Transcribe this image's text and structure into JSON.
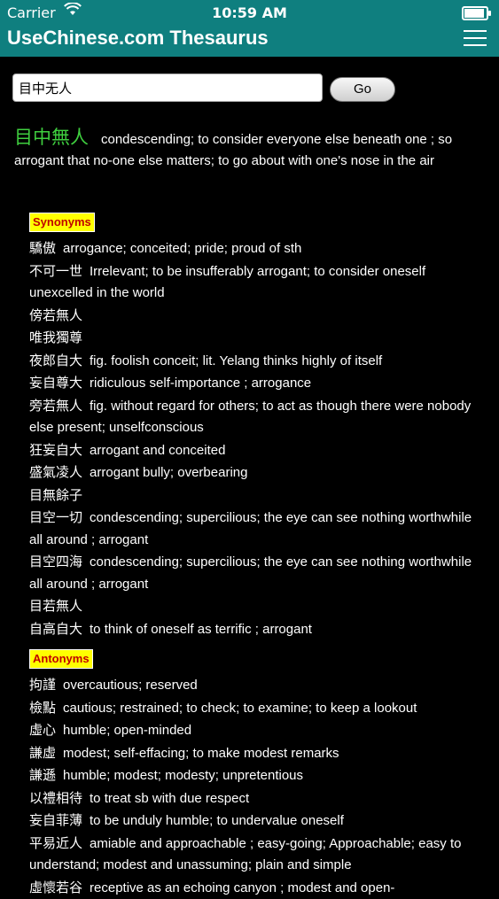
{
  "status_bar": {
    "carrier": "Carrier",
    "time": "10:59 AM"
  },
  "nav": {
    "title": "UseChinese.com Thesaurus"
  },
  "search": {
    "value": "目中无人",
    "go_label": "Go"
  },
  "entry": {
    "headword": "目中無人",
    "definition": "condescending; to consider everyone else beneath one ; so arrogant that no-one else matters; to go about with one's nose in the air"
  },
  "synonyms": {
    "label": "Synonyms",
    "items": [
      {
        "word": "驕傲",
        "def": "arrogance; conceited; pride; proud of sth"
      },
      {
        "word": "不可一世",
        "def": "Irrelevant; to be insufferably arrogant; to consider oneself unexcelled in the world"
      },
      {
        "word": "傍若無人",
        "def": ""
      },
      {
        "word": "唯我獨尊",
        "def": ""
      },
      {
        "word": "夜郎自大",
        "def": "fig. foolish conceit; lit. Yelang thinks highly of itself"
      },
      {
        "word": "妄自尊大",
        "def": "ridiculous self-importance ; arrogance"
      },
      {
        "word": "旁若無人",
        "def": "fig. without regard for others; to act as though there were nobody else present; unselfconscious"
      },
      {
        "word": "狂妄自大",
        "def": "arrogant and conceited"
      },
      {
        "word": "盛氣凌人",
        "def": "arrogant bully; overbearing"
      },
      {
        "word": "目無餘子",
        "def": ""
      },
      {
        "word": "目空一切",
        "def": "condescending; supercilious; the eye can see nothing worthwhile all around ; arrogant"
      },
      {
        "word": "目空四海",
        "def": "condescending; supercilious; the eye can see nothing worthwhile all around ; arrogant"
      },
      {
        "word": "目若無人",
        "def": ""
      },
      {
        "word": "自高自大",
        "def": "to think of oneself as terrific ; arrogant"
      }
    ]
  },
  "antonyms": {
    "label": "Antonyms",
    "items": [
      {
        "word": "拘謹",
        "def": "overcautious; reserved"
      },
      {
        "word": "檢點",
        "def": "cautious; restrained; to check; to examine; to keep a lookout"
      },
      {
        "word": "虛心",
        "def": "humble; open-minded"
      },
      {
        "word": "謙虛",
        "def": "modest; self-effacing; to make modest remarks"
      },
      {
        "word": "謙遜",
        "def": "humble; modest; modesty; unpretentious"
      },
      {
        "word": "以禮相待",
        "def": "to treat sb with due respect"
      },
      {
        "word": "妄自菲薄",
        "def": "to be unduly humble; to undervalue oneself"
      },
      {
        "word": "平易近人",
        "def": "amiable and approachable ; easy-going; Approachable; easy to understand; modest and unassuming; plain and simple"
      },
      {
        "word": "虛懷若谷",
        "def": "receptive as an echoing canyon ; modest and open-"
      }
    ]
  }
}
